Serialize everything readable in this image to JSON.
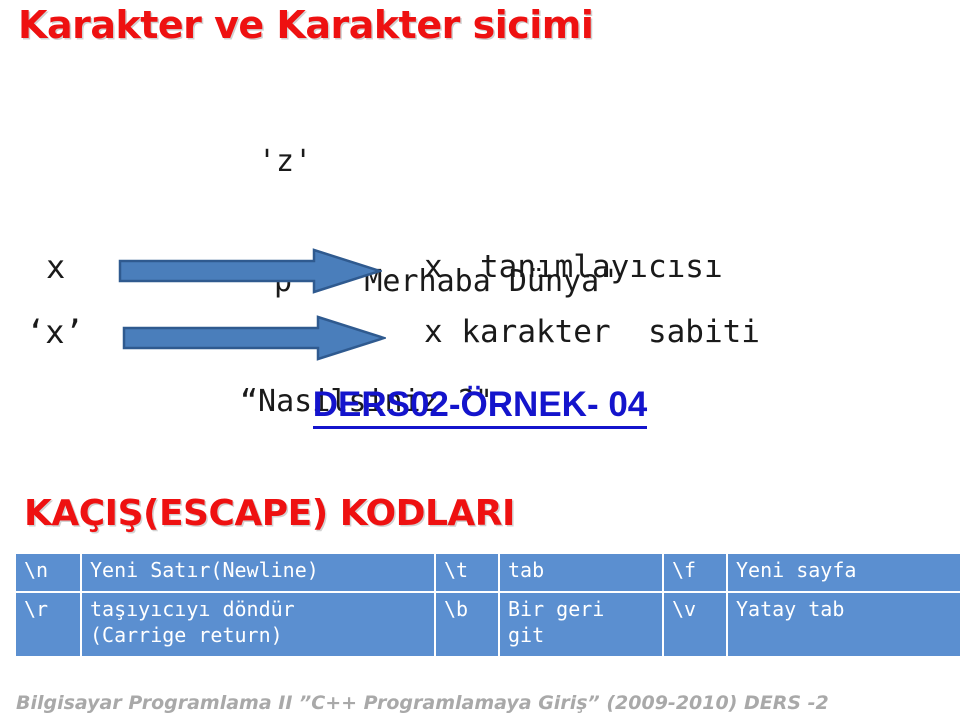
{
  "slide": {
    "title": "Karakter ve Karakter sicimi",
    "title_color": "#ee1111"
  },
  "code_block": {
    "line1": "'z'",
    "line2": "'p'  “Merhaba Dünya\"",
    "line3": "“Nasilsiniz ?\""
  },
  "arrow_rows": [
    {
      "left_label": "x",
      "arrow_icon": "right-arrow-icon",
      "right_label": "x  tanımlayıcısı"
    },
    {
      "left_label": "‘x’",
      "arrow_icon": "right-arrow-icon",
      "right_label": "x karakter  sabiti"
    }
  ],
  "arrow_style": {
    "fill": "#4a7ebb",
    "stroke": "#2f5a8f"
  },
  "ders_heading": {
    "text": "DERS02-ÖRNEK- 04",
    "color": "#1414cc"
  },
  "kacis_heading": {
    "text": "KAÇIŞ(ESCAPE) KODLARI",
    "color": "#ee1111"
  },
  "escape_table": {
    "cell_bg": "#5b8fd0",
    "cell_fg": "#ffffff",
    "rows": [
      {
        "code1": "\\n",
        "desc1": "Yeni Satır(Newline)",
        "code2": "\\t",
        "desc2": "tab",
        "code3": "\\f",
        "desc3": "Yeni sayfa"
      },
      {
        "code1": "\\r",
        "desc1": "taşıyıcıyı döndür\n(Carrige return)",
        "code2": "\\b",
        "desc2": "Bir geri\ngit",
        "code3": "\\v",
        "desc3": "Yatay tab"
      }
    ]
  },
  "footer": {
    "text": "Bilgisayar Programlama II  ”C++ Programlamaya Giriş” (2009-2010) DERS -2",
    "color": "#a9a9a9"
  }
}
